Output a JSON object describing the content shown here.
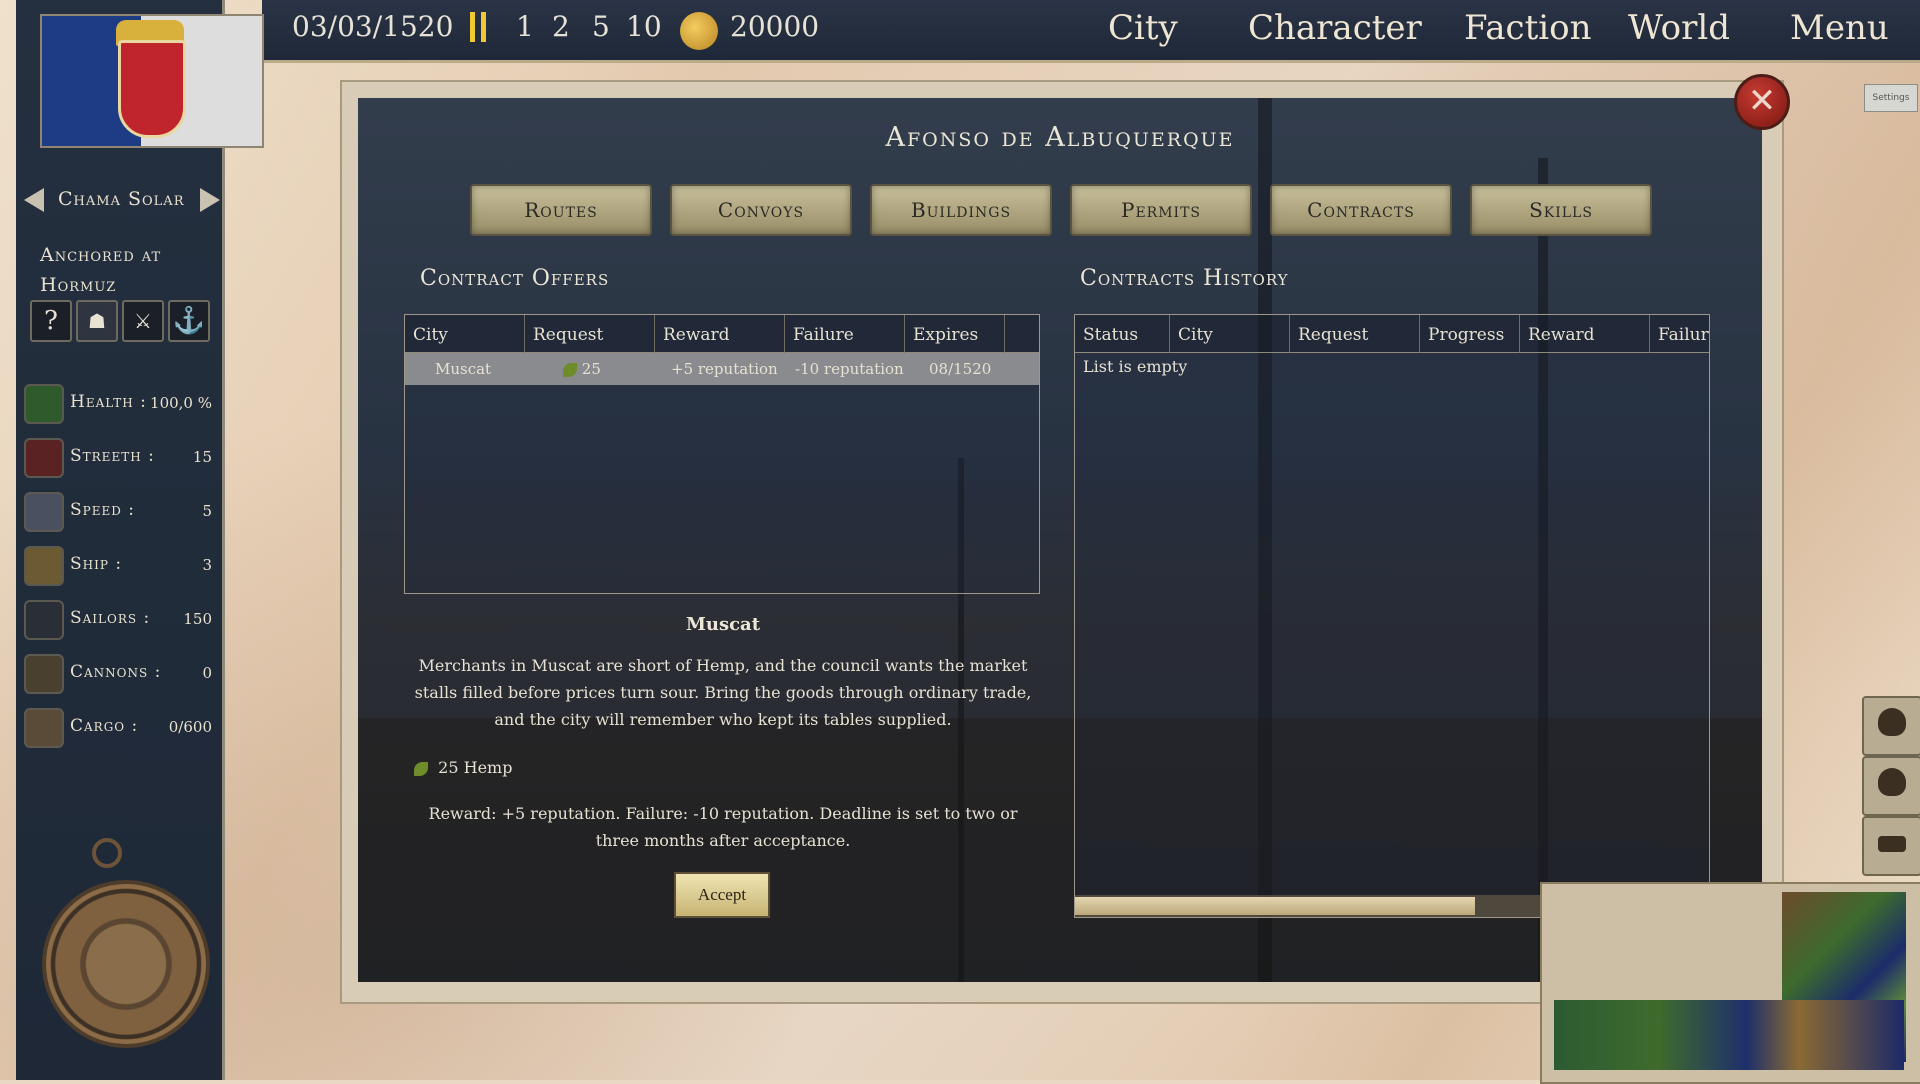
{
  "topbar": {
    "date": "03/03/1520",
    "speeds": [
      "1",
      "2",
      "5",
      "10"
    ],
    "gold": "20000",
    "nav": [
      "City",
      "Character",
      "Faction",
      "World",
      "Menu"
    ]
  },
  "sidebar": {
    "ship_name": "Chama Solar",
    "location_line1": "Anchored at",
    "location_line2": "Hormuz",
    "action_icons": [
      "question-icon",
      "crew-icon",
      "swords-icon",
      "anchor-icon"
    ],
    "stats": [
      {
        "label": "Health :",
        "value": "100,0 %",
        "icon": "health-icon"
      },
      {
        "label": "Streeth :",
        "value": "15",
        "icon": "strength-icon"
      },
      {
        "label": "Speed :",
        "value": "5",
        "icon": "speed-icon"
      },
      {
        "label": "Ship :",
        "value": "3",
        "icon": "ship-icon"
      },
      {
        "label": "Sailors :",
        "value": "150",
        "icon": "sailors-icon"
      },
      {
        "label": "Cannons :",
        "value": "0",
        "icon": "cannons-icon"
      },
      {
        "label": "Cargo :",
        "value": "0/600",
        "icon": "cargo-icon"
      }
    ]
  },
  "settings_label": "Settings",
  "panel": {
    "title": "Afonso de Albuquerque",
    "tabs": [
      "Routes",
      "Convoys",
      "Buildings",
      "Permits",
      "Contracts",
      "Skills"
    ],
    "offers": {
      "heading": "Contract Offers",
      "columns": [
        "City",
        "Request",
        "Reward",
        "Failure",
        "Expires"
      ],
      "rows": [
        {
          "city": "Muscat",
          "request": "25",
          "reward": "+5 reputation",
          "failure": "-10 reputation",
          "expires": "08/1520"
        }
      ]
    },
    "history": {
      "heading": "Contracts History",
      "columns": [
        "Status",
        "City",
        "Request",
        "Progress",
        "Reward",
        "Failure"
      ],
      "empty": "List is empty"
    },
    "detail": {
      "city": "Muscat",
      "description": "Merchants in Muscat are short of Hemp, and the council wants the market stalls filled before prices turn sour. Bring the goods through ordinary trade, and the city will remember who kept its tables supplied.",
      "request": "25 Hemp",
      "terms": "Reward: +5 reputation. Failure: -10 reputation. Deadline is set to two or three months after acceptance.",
      "accept_label": "Accept"
    }
  },
  "colors": {
    "topbar": "#1f2838",
    "pause_accent": "#f0c832",
    "tab_face": "#b8ae86",
    "close_red": "#a8281f"
  }
}
